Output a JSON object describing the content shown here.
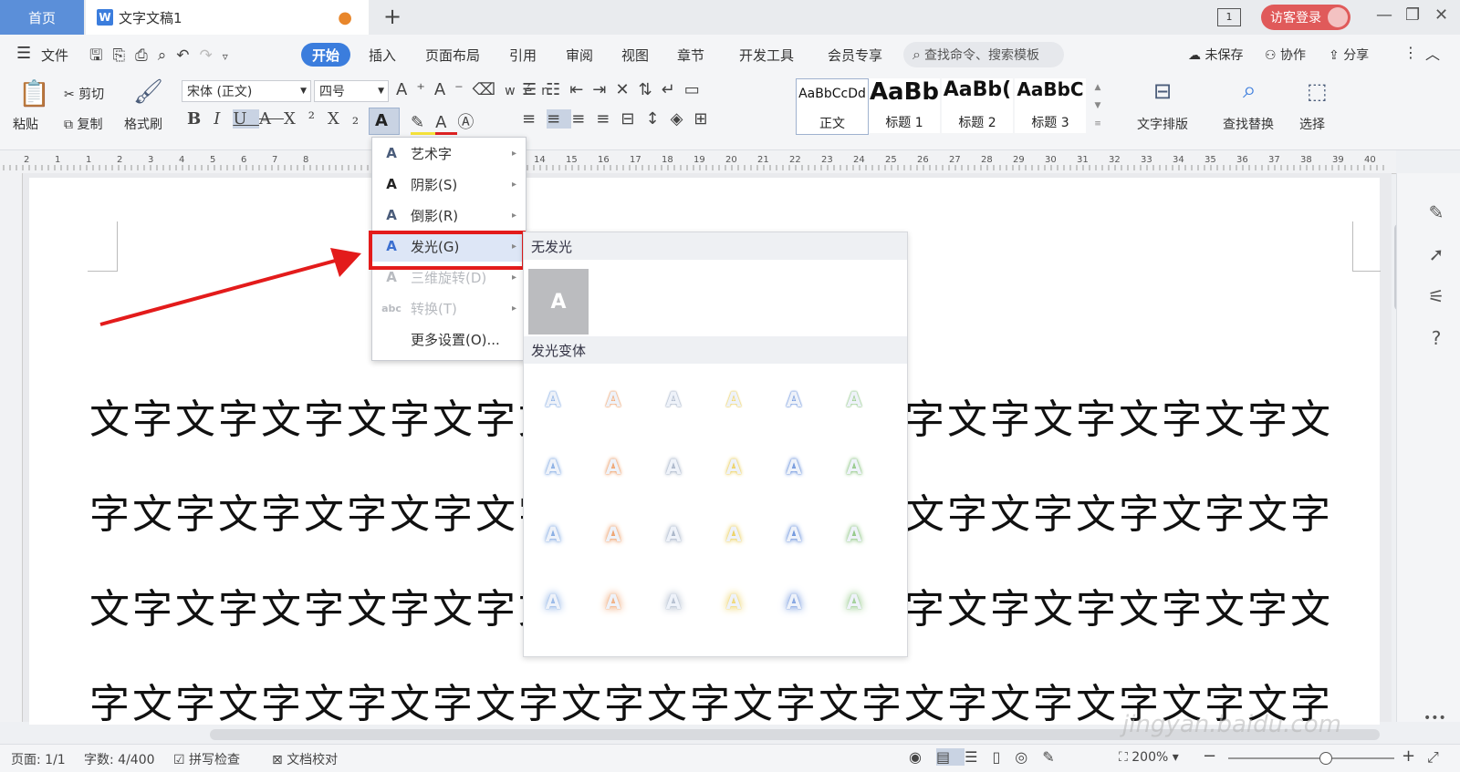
{
  "titlebar": {
    "home_tab": "首页",
    "doc_tab": "文字文稿1",
    "doc_icon": "W",
    "login": "访客登录"
  },
  "menubar": {
    "file": "文件",
    "tabs": [
      "开始",
      "插入",
      "页面布局",
      "引用",
      "审阅",
      "视图",
      "章节",
      "开发工具",
      "会员专享"
    ],
    "search_placeholder": "查找命令、搜索模板",
    "unsaved": "未保存",
    "collab": "协作",
    "share": "分享"
  },
  "ribbon": {
    "paste": "粘贴",
    "cut": "剪切",
    "copy": "复制",
    "format_painter": "格式刷",
    "font_name": "宋体 (正文)",
    "font_size": "四号",
    "styles": [
      {
        "sample": "AaBbCcDd",
        "name": "正文"
      },
      {
        "sample": "AaBb",
        "name": "标题 1"
      },
      {
        "sample": "AaBb(",
        "name": "标题 2"
      },
      {
        "sample": "AaBbC",
        "name": "标题 3"
      }
    ],
    "text_layout": "文字排版",
    "find_replace": "查找替换",
    "select": "选择"
  },
  "ruler_numbers": [
    "2",
    "1",
    "1",
    "2",
    "3",
    "4",
    "5",
    "6",
    "7",
    "8",
    "14",
    "15",
    "16",
    "17",
    "18",
    "19",
    "20",
    "21",
    "22",
    "23",
    "24",
    "25",
    "26",
    "27",
    "28",
    "29",
    "30",
    "31",
    "32",
    "33",
    "34",
    "35",
    "36",
    "37",
    "38",
    "39",
    "40"
  ],
  "document": {
    "lines": [
      "文字文字文字文字文字文字文字文字文字文字文字文字文字文字文字文",
      "字文字文字文字文字文字文字文字文字文字文字文字文字文字文字文字",
      "文字文字文字文字文字文字文字文字文字文字文字文字文字文字文字文",
      "字文字文字文字文字文字文字文字文字文字文字文字文字文字文字文字"
    ]
  },
  "effects_menu": {
    "items": [
      {
        "label": "艺术字",
        "enabled": true
      },
      {
        "label": "阴影(S)",
        "enabled": true
      },
      {
        "label": "倒影(R)",
        "enabled": true
      },
      {
        "label": "发光(G)",
        "enabled": true
      },
      {
        "label": "三维旋转(D)",
        "enabled": false
      },
      {
        "label": "转换(T)",
        "enabled": false
      }
    ],
    "more": "更多设置(O)..."
  },
  "glow_gallery": {
    "no_glow_header": "无发光",
    "no_glow_sample": "A",
    "variants_header": "发光变体",
    "sample": "A",
    "colors": [
      "#5b8fd9",
      "#e8823b",
      "#8a9bb5",
      "#e6c12c",
      "#3b6fd0",
      "#6cb45c"
    ]
  },
  "statusbar": {
    "page": "页面: 1/1",
    "words": "字数: 4/400",
    "spell": "拼写检查",
    "proof": "文档校对",
    "zoom": "200%"
  },
  "watermark": {
    "text": "jingyan.baidu.com"
  }
}
